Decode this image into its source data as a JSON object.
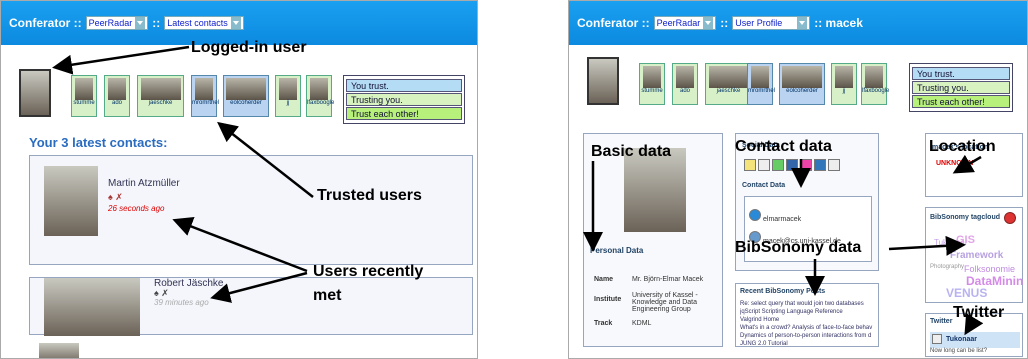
{
  "left": {
    "app_title": "Conferator ::",
    "select1": "PeerRadar",
    "sep": "::",
    "select2": "Latest contacts",
    "tiles": [
      "stumme",
      "ado",
      "jaeschke",
      "mromrthel",
      "eolcoherder",
      "jj",
      "lfaxboogle"
    ],
    "legend": [
      "You trust.",
      "Trusting you.",
      "Trust each other!"
    ],
    "latest_heading": "Your 3 latest contacts:",
    "contacts": [
      {
        "name": "Martin Atzmüller",
        "time": "26 seconds ago"
      },
      {
        "name": "Robert Jäschke",
        "time": "39 minutes ago"
      }
    ],
    "annotations": {
      "logged": "Logged-in user",
      "trusted": "Trusted users",
      "recent1": "Users recently",
      "recent2": "met"
    }
  },
  "right": {
    "app_title": "Conferator ::",
    "select1": "PeerRadar",
    "sep": "::",
    "select2": "User Profile",
    "sep2": ":: macek",
    "tiles": [
      "stumme",
      "ado",
      "jaeschke",
      "mromrthel",
      "eolcoherder",
      "jj",
      "lfaxboogle"
    ],
    "legend": [
      "You trust.",
      "Trusting you.",
      "Trust each other!"
    ],
    "annotations": {
      "basic": "Basic data",
      "contact": "Contact data",
      "location": "Location",
      "bibsonomy": "BibSonomy data",
      "twitter": "Twitter"
    },
    "social_data": "Social Data",
    "contact_data": "Contact Data",
    "contact_items": [
      "elmarmacek",
      "macek@cs.uni-kassel.de"
    ],
    "location_title": "macek's location",
    "location_value": "UNKNOWN",
    "tagcloud_title": "BibSonomy tagcloud",
    "tags": [
      "GIS",
      "Framework",
      "DataMinin",
      "Tukonaar",
      "VENUS",
      "Folksonomie",
      "Photography"
    ],
    "personal_data": "Personal Data",
    "fields": [
      {
        "label": "Name",
        "value": "Mr. Björn-Elmar Macek"
      },
      {
        "label": "Institute",
        "value": "University of Kassel - Knowledge and Data Engineering Group"
      },
      {
        "label": "Track",
        "value": "KDML"
      }
    ],
    "posts_title": "Recent BibSonomy Posts",
    "posts": [
      "Re: select query that would join two databases",
      "jqScript Scripting Language Reference",
      "Valgrind Home",
      "What's in a crowd? Analysis of face-to-face behav",
      "Dynamics of person-to-person interactions from d",
      "JUNG 2.0 Tutorial"
    ],
    "twitter_title": "Twitter",
    "twitter_user": "Tukonaar",
    "twitter_text": "Now long can be list?"
  },
  "colors": {
    "bar": "#1aa0f0",
    "annotation": "#000000",
    "unknown": "#dd0000"
  }
}
